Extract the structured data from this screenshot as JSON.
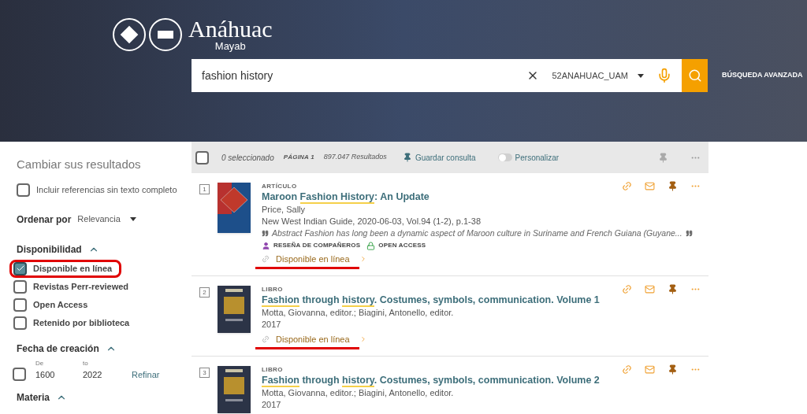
{
  "header": {
    "logo": {
      "name": "Anáhuac",
      "subtitle": "Mayab"
    },
    "search": {
      "value": "fashion history",
      "scope": "52ANAHUAC_UAM"
    },
    "advanced_link": "BÚSQUEDA AVANZADA"
  },
  "sidebar": {
    "title": "Cambiar sus resultados",
    "full_text_option": {
      "label": "Incluir referencias sin texto completo",
      "checked": false
    },
    "sort": {
      "label": "Ordenar por",
      "value": "Relevancia"
    },
    "availability": {
      "heading": "Disponibilidad",
      "expanded": true,
      "options": [
        {
          "label": "Disponible en línea",
          "checked": true,
          "annotated": true
        },
        {
          "label": "Revistas Perr-reviewed",
          "checked": false,
          "annotated": false
        },
        {
          "label": "Open Access",
          "checked": false,
          "annotated": false
        },
        {
          "label": "Retenido por biblioteca",
          "checked": false,
          "annotated": false
        }
      ]
    },
    "date": {
      "heading": "Fecha de creación",
      "expanded": true,
      "from_label": "De",
      "to_label": "to",
      "from": "1600",
      "to": "2022",
      "checked": false,
      "refine": "Refinar"
    },
    "subject": {
      "heading": "Materia",
      "expanded": true
    }
  },
  "toolbar": {
    "select_all_checked": false,
    "selected": "0 seleccionado",
    "page": "PÁGINA 1",
    "results": "897.047 Resultados",
    "save": "Guardar consulta",
    "personalize": {
      "label": "Personalizar",
      "on": false
    }
  },
  "results": [
    {
      "number": "1",
      "type": "ARTÍCULO",
      "kind": "article",
      "title": [
        {
          "text": "Maroon ",
          "highlighted": false
        },
        {
          "text": "Fashion History",
          "highlighted": true
        },
        {
          "text": ": An Update",
          "highlighted": false
        }
      ],
      "lines": [
        "Price, Sally",
        "New West Indian Guide, 2020-06-03, Vol.94 (1-2), p.1-38"
      ],
      "abstract": "Abstract Fashion has long been a dynamic aspect of Maroon culture in Suriname and French Guiana (Guyane...",
      "badges": [
        {
          "kind": "peer",
          "label": "RESEÑA DE COMPAÑEROS"
        },
        {
          "kind": "open",
          "label": "OPEN ACCESS"
        }
      ],
      "availability": "Disponible en línea",
      "annotated": true
    },
    {
      "number": "2",
      "type": "LIBRO",
      "kind": "book",
      "title": [
        {
          "text": "Fashion",
          "highlighted": true
        },
        {
          "text": " through ",
          "highlighted": false
        },
        {
          "text": "history",
          "highlighted": true
        },
        {
          "text": ". Costumes, symbols, communication. Volume 1",
          "highlighted": false
        }
      ],
      "lines": [
        "Motta, Giovanna, editor.; Biagini, Antonello, editor.",
        "2017"
      ],
      "availability": "Disponible en línea",
      "annotated": true
    },
    {
      "number": "3",
      "type": "LIBRO",
      "kind": "book",
      "title": [
        {
          "text": "Fashion",
          "highlighted": true
        },
        {
          "text": " through ",
          "highlighted": false
        },
        {
          "text": "history",
          "highlighted": true
        },
        {
          "text": ". Costumes, symbols, communication. Volume 2",
          "highlighted": false
        }
      ],
      "lines": [
        "Motta, Giovanna, editor.; Biagini, Antonello, editor.",
        "2017"
      ]
    }
  ]
}
